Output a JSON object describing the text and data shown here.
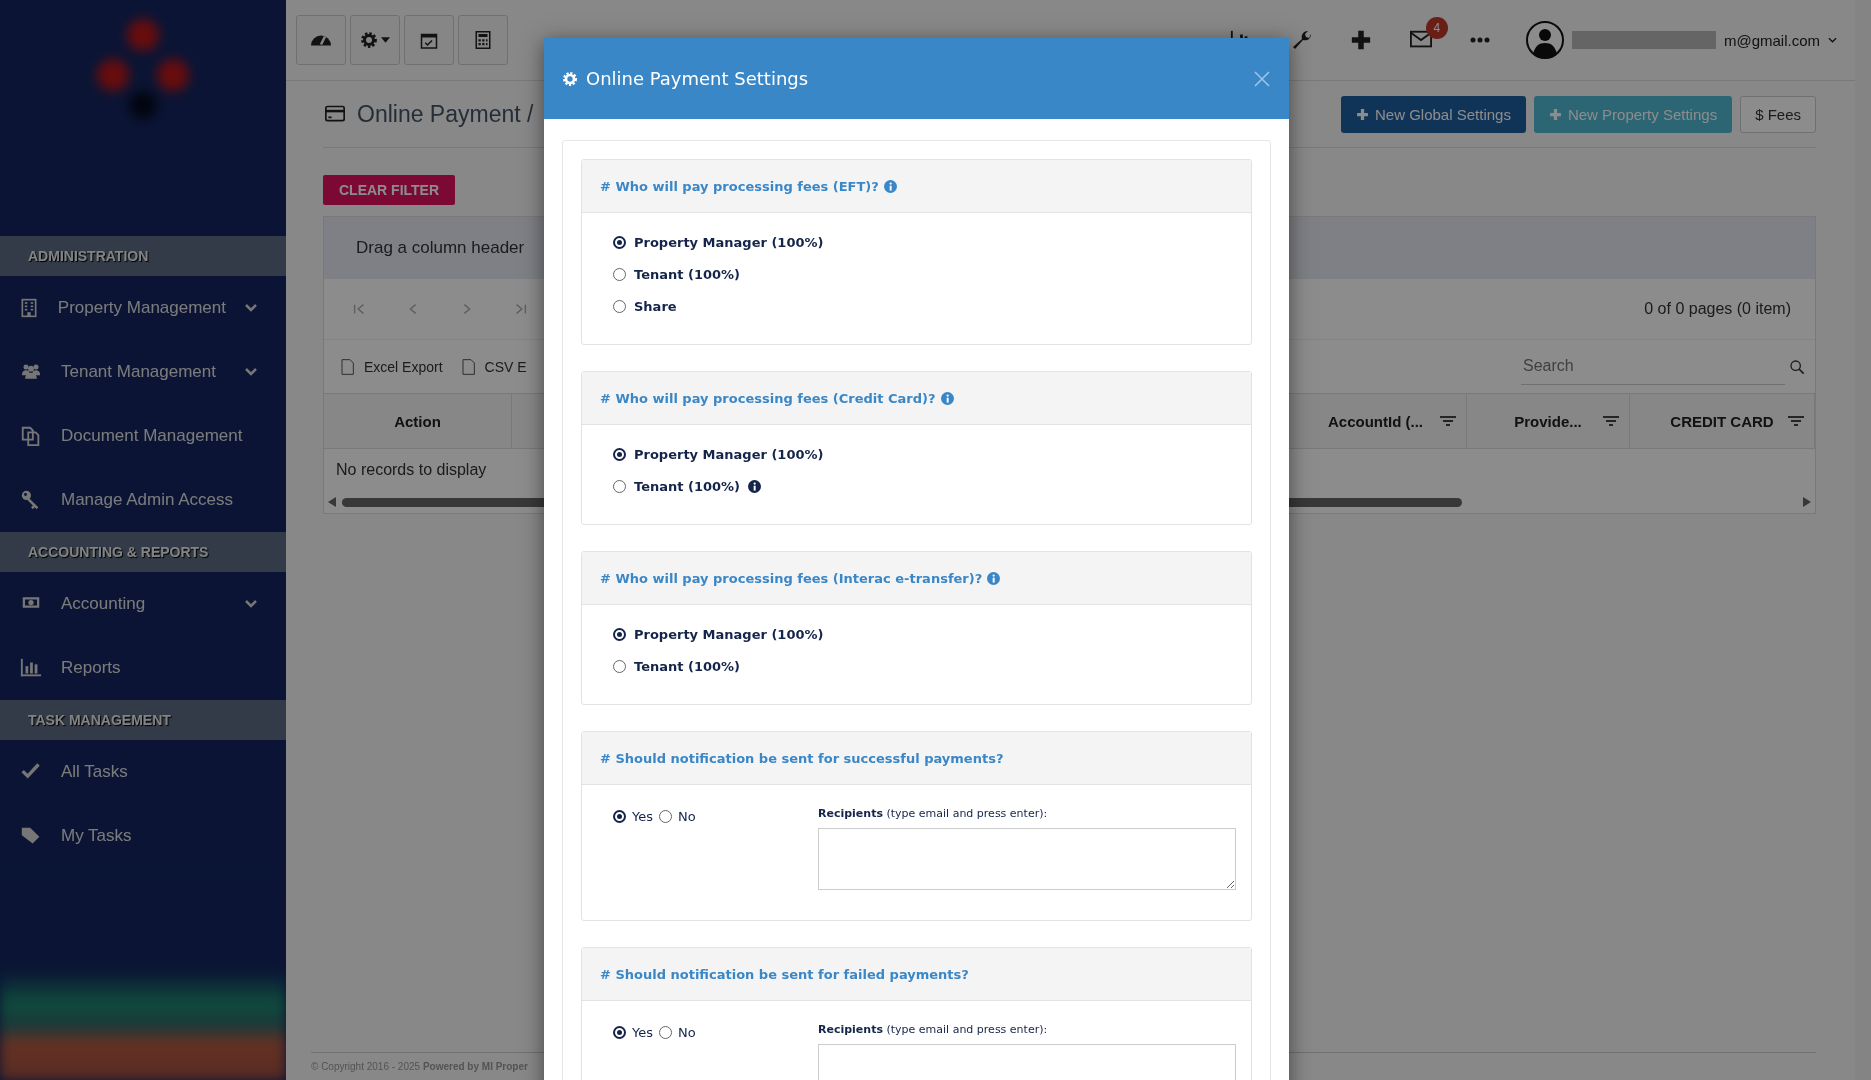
{
  "sidebar": {
    "sections": [
      {
        "title": "ADMINISTRATION",
        "items": [
          {
            "label": "Property Management",
            "has_submenu": true
          },
          {
            "label": "Tenant Management",
            "has_submenu": true
          },
          {
            "label": "Document Management",
            "has_submenu": false
          },
          {
            "label": "Manage Admin Access",
            "has_submenu": false
          }
        ]
      },
      {
        "title": "ACCOUNTING & REPORTS",
        "items": [
          {
            "label": "Accounting",
            "has_submenu": true
          },
          {
            "label": "Reports",
            "has_submenu": false
          }
        ]
      },
      {
        "title": "TASK MANAGEMENT",
        "items": [
          {
            "label": "All Tasks",
            "has_submenu": false
          },
          {
            "label": "My Tasks",
            "has_submenu": false
          }
        ]
      }
    ]
  },
  "topbar": {
    "notification_count": "4",
    "user_email": "m@gmail.com"
  },
  "page": {
    "breadcrumb": "Online Payment /",
    "buttons": [
      {
        "label": "New Global Settings",
        "kind": "primary"
      },
      {
        "label": "New Property Settings",
        "kind": "info"
      },
      {
        "label": "$ Fees",
        "kind": "plain"
      }
    ],
    "clear_filter": "CLEAR FILTER"
  },
  "grid": {
    "group_hint": "Drag a column header",
    "pager_info": "0 of 0 pages (0 item)",
    "exports": [
      "Excel Export",
      "CSV E"
    ],
    "search": {
      "placeholder": "Search"
    },
    "columns": [
      {
        "label": "Action",
        "filter": false
      },
      {
        "filter": false
      },
      {
        "label": "AccountId (...",
        "filter": true
      },
      {
        "label": "Provide...",
        "filter": true
      },
      {
        "label": "CREDIT CARD",
        "filter": true
      }
    ],
    "empty_text": "No records to display"
  },
  "footer": "© Copyright 2016 - 2025 **Powered by MI Proper**",
  "modal": {
    "title": "Online Payment Settings",
    "sections": [
      {
        "kind": "choice",
        "title": "# Who will pay processing fees (EFT)?",
        "info": true,
        "options": [
          {
            "label": "Property Manager (100%)",
            "selected": true,
            "info": false
          },
          {
            "label": "Tenant (100%)",
            "selected": false,
            "info": false
          },
          {
            "label": "Share",
            "selected": false,
            "info": false
          }
        ]
      },
      {
        "kind": "choice",
        "title": "# Who will pay processing fees (Credit Card)?",
        "info": true,
        "options": [
          {
            "label": "Property Manager (100%)",
            "selected": true,
            "info": false
          },
          {
            "label": "Tenant (100%)",
            "selected": false,
            "info": true
          }
        ]
      },
      {
        "kind": "choice",
        "title": "# Who will pay processing fees (Interac e-transfer)?",
        "info": true,
        "options": [
          {
            "label": "Property Manager (100%)",
            "selected": true,
            "info": false
          },
          {
            "label": "Tenant (100%)",
            "selected": false,
            "info": false
          }
        ]
      },
      {
        "kind": "notify",
        "title": "# Should notification be sent for successful payments?",
        "info": false,
        "options": [
          {
            "label": "Yes",
            "selected": true
          },
          {
            "label": "No",
            "selected": false
          }
        ],
        "recipients_label": "**Recipients** (type email and press enter):"
      },
      {
        "kind": "notify",
        "title": "# Should notification be sent for failed payments?",
        "info": false,
        "options": [
          {
            "label": "Yes",
            "selected": true
          },
          {
            "label": "No",
            "selected": false
          }
        ],
        "recipients_label": "**Recipients** (type email and press enter):"
      }
    ]
  }
}
